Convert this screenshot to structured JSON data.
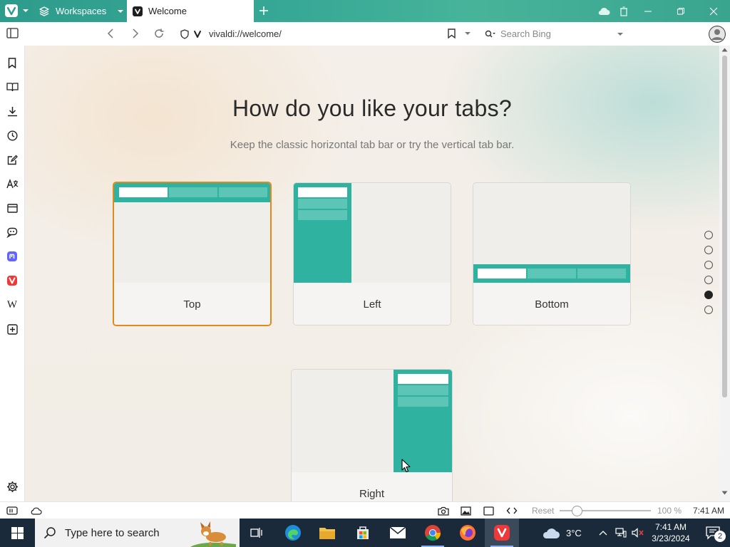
{
  "browser": {
    "workspaces_label": "Workspaces",
    "active_tab_title": "Welcome",
    "url": "vivaldi://welcome/",
    "search_placeholder": "Search Bing"
  },
  "page": {
    "headline": "How do you like your tabs?",
    "subline": "Keep the classic horizontal tab bar or try the vertical tab bar.",
    "options": [
      {
        "label": "Top",
        "selected": true
      },
      {
        "label": "Left",
        "selected": false
      },
      {
        "label": "Bottom",
        "selected": false
      },
      {
        "label": "Right",
        "selected": false
      }
    ],
    "step_dots": {
      "count": 6,
      "active_index": 4
    }
  },
  "sidebar": {
    "icons": [
      "bookmark-icon",
      "reading-list-icon",
      "downloads-icon",
      "history-icon",
      "notes-icon",
      "translate-icon",
      "calendar-icon",
      "feed-icon",
      "mastodon-icon",
      "vivaldi-icon",
      "wikipedia-icon",
      "add-panel-icon",
      "settings-icon"
    ],
    "wikipedia_glyph": "W"
  },
  "statusbar": {
    "reset_label": "Reset",
    "zoom_level": "100 %",
    "zoom_value": 1.0,
    "time": "7:41 AM"
  },
  "taskbar": {
    "search_placeholder": "Type here to search",
    "weather_temp": "3°C",
    "clock_time": "7:41 AM",
    "clock_date": "3/23/2024",
    "notifications_count": "2"
  },
  "colors": {
    "accent_teal": "#2fb3a0",
    "selected_border": "#e08a1a",
    "vivaldi_red": "#ef3939"
  }
}
